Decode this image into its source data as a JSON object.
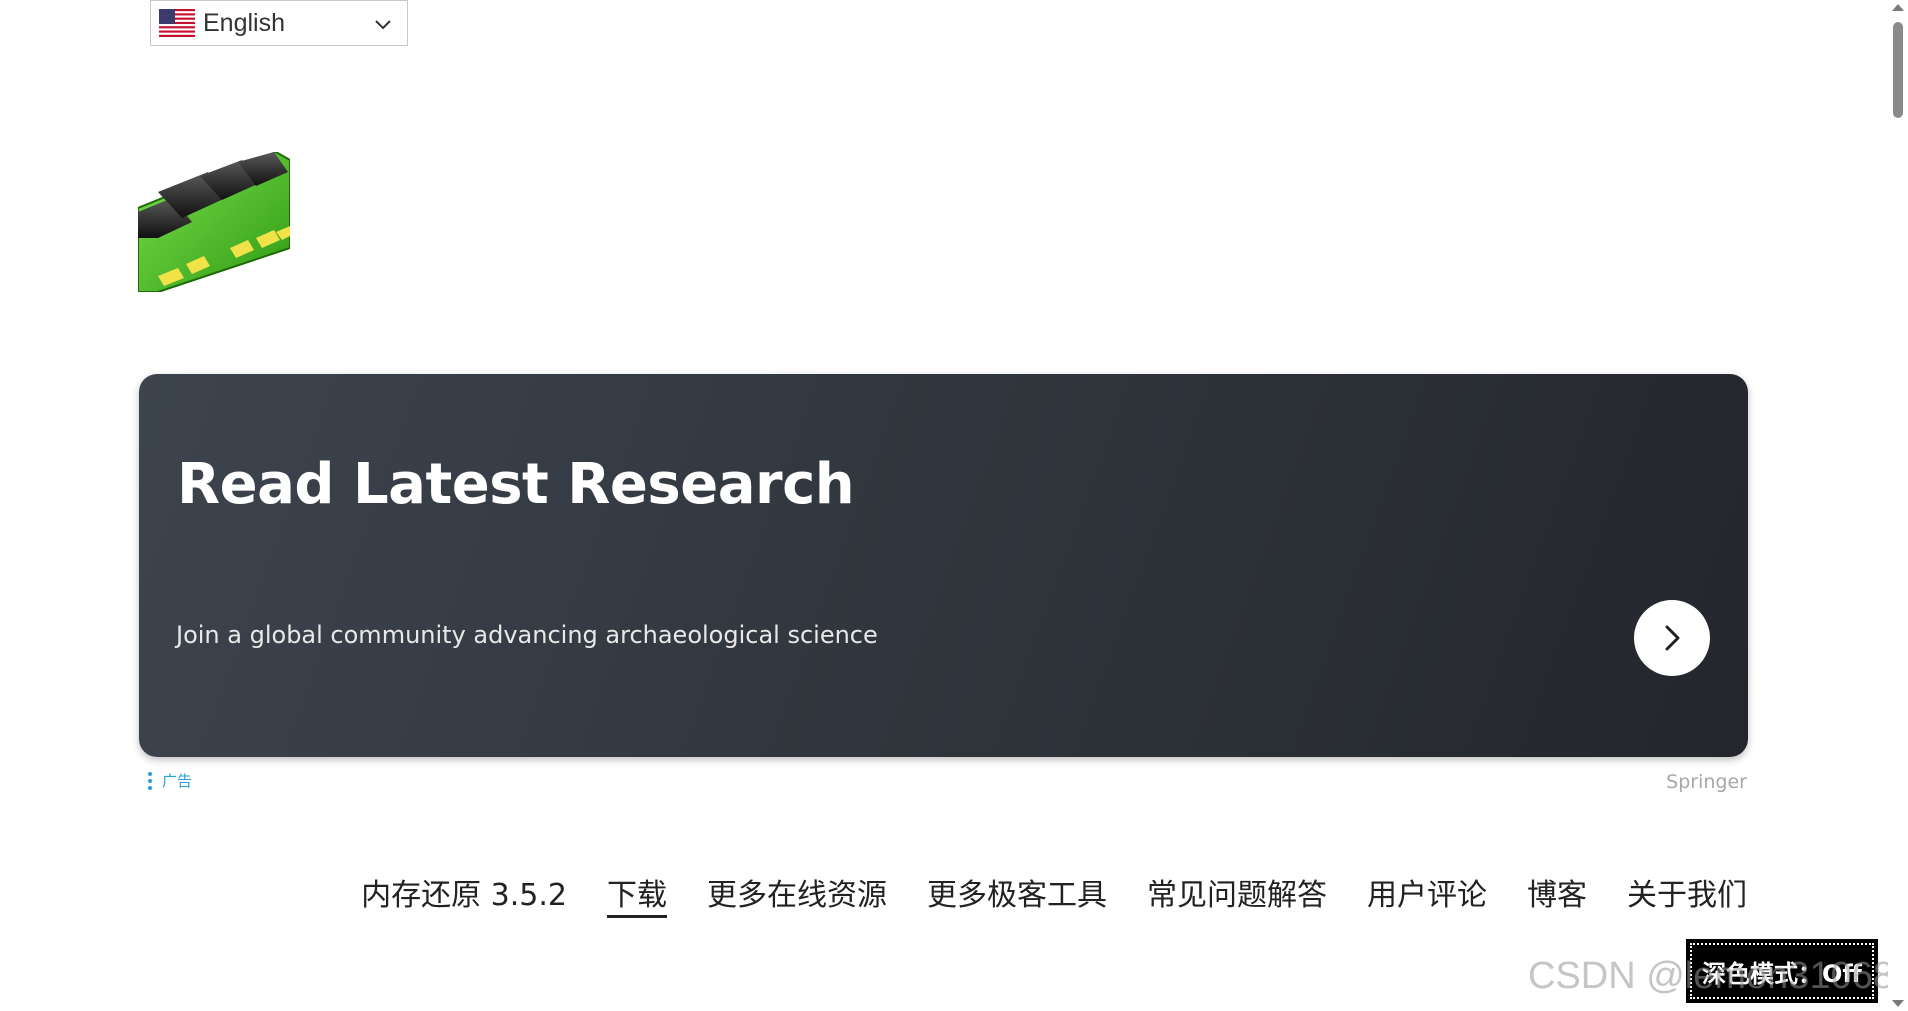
{
  "language_selector": {
    "selected": "English",
    "flag_icon": "us-flag-icon",
    "chevron_icon": "chevron-down-icon"
  },
  "logo": {
    "icon": "ram-module-icon"
  },
  "ad": {
    "title": "Read Latest Research",
    "subtitle": "Join a global community advancing archaeological science",
    "arrow_icon": "chevron-right-icon",
    "info_label": "广告",
    "source": "Springer",
    "colors": {
      "card_start": "#3d444e",
      "card_end": "#23262c",
      "info": "#2a9fd6"
    }
  },
  "nav": {
    "items": [
      {
        "label": "内存还原 3.5.2",
        "active": false
      },
      {
        "label": "下载",
        "active": true
      },
      {
        "label": "更多在线资源",
        "active": false
      },
      {
        "label": "更多极客工具",
        "active": false
      },
      {
        "label": "常见问题解答",
        "active": false
      },
      {
        "label": "用户评论",
        "active": false
      },
      {
        "label": "博客",
        "active": false
      },
      {
        "label": "关于我们",
        "active": false
      }
    ]
  },
  "dark_mode": {
    "label": "深色模式：Off"
  },
  "watermark": {
    "text": "CSDN @lemon3106824"
  }
}
